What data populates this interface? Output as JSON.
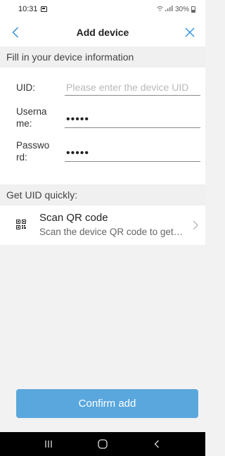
{
  "status_bar": {
    "time": "10:31",
    "battery": "30%",
    "notification_icon": "calendar-icon",
    "wifi_icon": "wifi-icon",
    "signal_icon": "signal-icon",
    "battery_icon": "battery-icon"
  },
  "header": {
    "title": "Add device",
    "back_icon": "back-arrow-icon",
    "close_icon": "close-icon",
    "accent_color": "#2f8fdc"
  },
  "form": {
    "section_title": "Fill in your device information",
    "uid": {
      "label": "UID:",
      "value": "",
      "placeholder": "Please enter the device UID"
    },
    "username": {
      "label": "Username:",
      "value": "•••••"
    },
    "password": {
      "label": "Password:",
      "value": "•••••"
    }
  },
  "quick": {
    "section_title": "Get UID quickly:",
    "scan": {
      "icon": "qr-code-icon",
      "title": "Scan QR code",
      "subtitle": "Scan the device QR code to get the UID",
      "chevron_icon": "chevron-right-icon"
    }
  },
  "confirm": {
    "label": "Confirm add",
    "color": "#5aa7de"
  },
  "nav": {
    "recent_icon": "recent-apps-icon",
    "home_icon": "home-icon",
    "back_icon": "back-icon"
  }
}
